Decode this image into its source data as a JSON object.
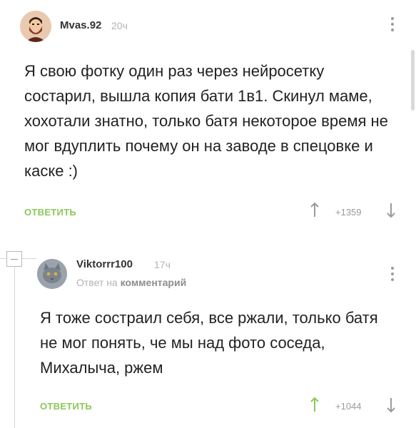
{
  "comments": [
    {
      "username": "Mvas.92",
      "time": "20ч",
      "text": "Я свою фотку один раз через нейросетку состарил, вышла копия бати 1в1. Скинул маме, хохотали знатно, только батя некоторое время не мог вдуплить почему он на заводе в спецовке и каске :)",
      "reply_label": "ОТВЕТИТЬ",
      "rating": "+1359",
      "upvoted": false
    },
    {
      "username": "Viktorrr100",
      "time": "17ч",
      "reply_to_prefix": "Ответ на",
      "reply_to_target": "комментарий",
      "text": "Я тоже состраил себя, все ржали, только батя не мог понять, че мы над фото соседа, Михалыча, ржем",
      "reply_label": "ОТВЕТИТЬ",
      "rating": "+1044",
      "upvoted": true
    }
  ],
  "colors": {
    "accent_green": "#8ac858",
    "muted": "#9a9a9a"
  },
  "icons": [
    "avatar-bearded-man",
    "avatar-cat",
    "kebab-menu-icon",
    "upvote-arrow-icon",
    "downvote-arrow-icon",
    "collapse-thread-icon"
  ]
}
